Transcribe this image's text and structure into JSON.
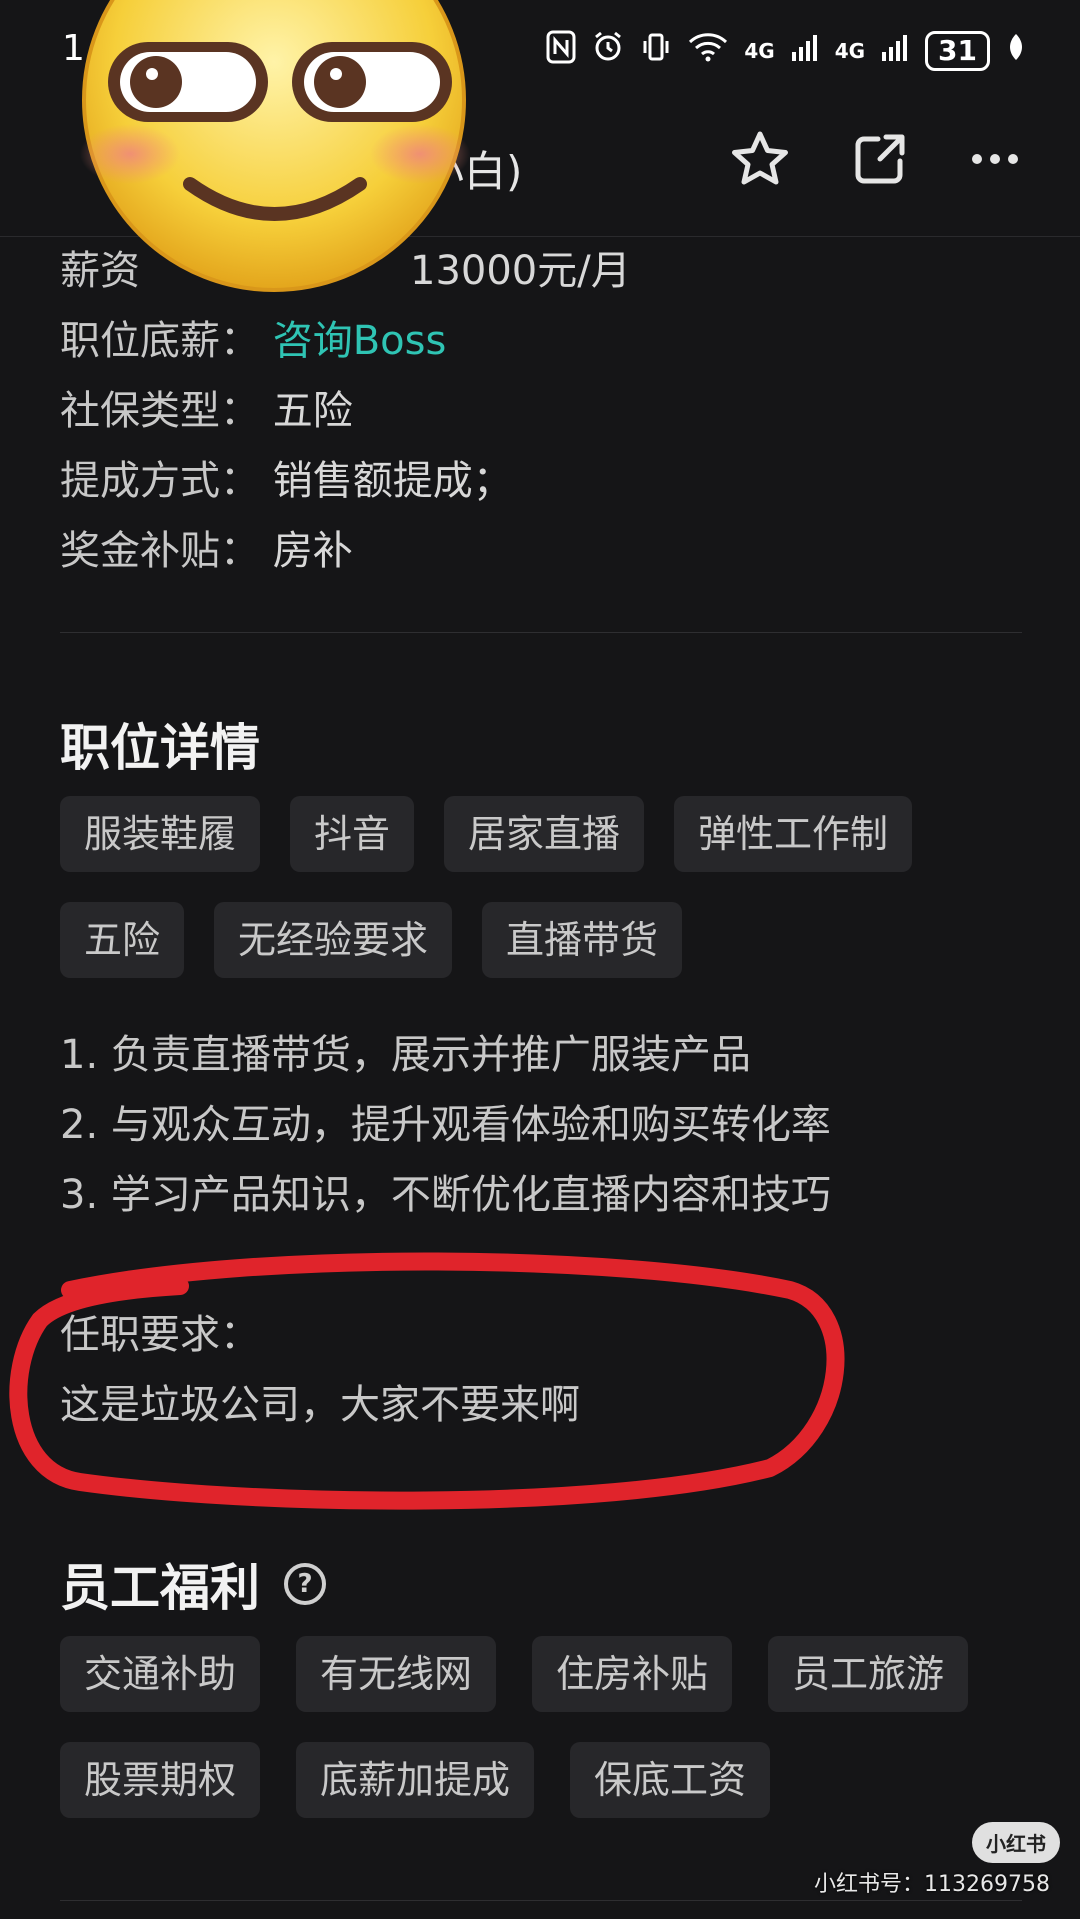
{
  "status_bar": {
    "time": "1",
    "network_1": "4G",
    "network_2": "4G",
    "battery": "31"
  },
  "header": {
    "title_fragment": "受小白)"
  },
  "salary_info": [
    {
      "label": "薪资",
      "value": "13000元/月",
      "highlight": false
    },
    {
      "label": "职位底薪：",
      "value": "咨询Boss",
      "highlight": true
    },
    {
      "label": "社保类型：",
      "value": "五险",
      "highlight": false
    },
    {
      "label": "提成方式：",
      "value": "销售额提成；",
      "highlight": false
    },
    {
      "label": "奖金补贴：",
      "value": "房补",
      "highlight": false
    }
  ],
  "job_details": {
    "title": "职位详情",
    "tags": [
      "服装鞋履",
      "抖音",
      "居家直播",
      "弹性工作制",
      "五险",
      "无经验要求",
      "直播带货"
    ],
    "duties": [
      "1. 负责直播带货，展示并推广服装产品",
      "2. 与观众互动，提升观看体验和购买转化率",
      "3. 学习产品知识，不断优化直播内容和技巧"
    ],
    "requirements_label": "任职要求：",
    "requirements_text": "这是垃圾公司，大家不要来啊"
  },
  "welfare": {
    "title": "员工福利",
    "help_glyph": "?",
    "tags": [
      "交通补助",
      "有无线网",
      "住房补贴",
      "员工旅游",
      "股票期权",
      "底薪加提成",
      "保底工资"
    ]
  },
  "watermark": {
    "badge": "小红书",
    "text": "小红书号：113269758"
  },
  "colors": {
    "background": "#151517",
    "link": "#2fc4b4",
    "tag_bg": "#27272a",
    "annotation_red": "#e0242b"
  }
}
